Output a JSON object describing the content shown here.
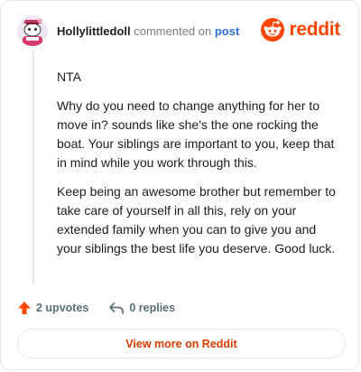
{
  "header": {
    "username": "Hollylittledoll",
    "action_text": " commented on ",
    "post_link": "post",
    "logo_text": "reddit",
    "avatar_icon": "snoo-avatar-icon",
    "logo_icon": "reddit-snoo-icon"
  },
  "comment": {
    "paragraphs": [
      "NTA",
      "Why do you need to change anything for her to move in? sounds like she's the one rocking the boat. Your siblings are important to you, keep that in mind while you work through this.",
      "Keep being an awesome brother but remember to take care of yourself in all this, rely on your extended family when you can to give you and your siblings the best life you deserve. Good luck."
    ]
  },
  "actions": {
    "upvotes": "2 upvotes",
    "replies": "0 replies",
    "upvote_icon": "upvote-arrow-icon",
    "reply_icon": "reply-arrow-icon"
  },
  "footer": {
    "view_more": "View more on Reddit"
  },
  "colors": {
    "brand": "#ff4500",
    "upvote": "#ff4500",
    "link": "#2d6fd6",
    "view_more": "#d93a00",
    "muted": "#576f76"
  }
}
